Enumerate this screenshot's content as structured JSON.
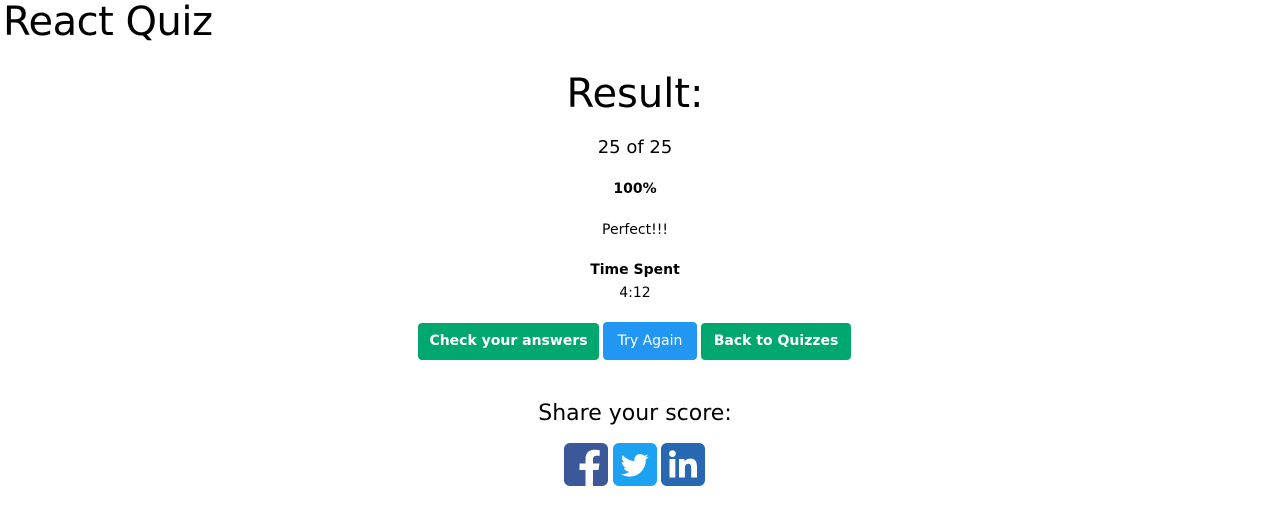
{
  "app": {
    "title": "React Quiz"
  },
  "result": {
    "heading": "Result:",
    "score_text": "25 of 25",
    "percentage": "100%",
    "message": "Perfect!!!",
    "time_label": "Time Spent",
    "time_value": "4:12"
  },
  "actions": {
    "check_answers_label": "Check your answers",
    "try_again_label": "Try Again",
    "back_label": "Back to Quizzes"
  },
  "share": {
    "label": "Share your score:",
    "networks": [
      {
        "name": "facebook-icon",
        "color": "#3b5998"
      },
      {
        "name": "twitter-icon",
        "color": "#1da1f2"
      },
      {
        "name": "linkedin-icon",
        "color": "#2867b2"
      }
    ]
  },
  "colors": {
    "primary_green": "#00a76f",
    "primary_blue": "#2196f3"
  }
}
